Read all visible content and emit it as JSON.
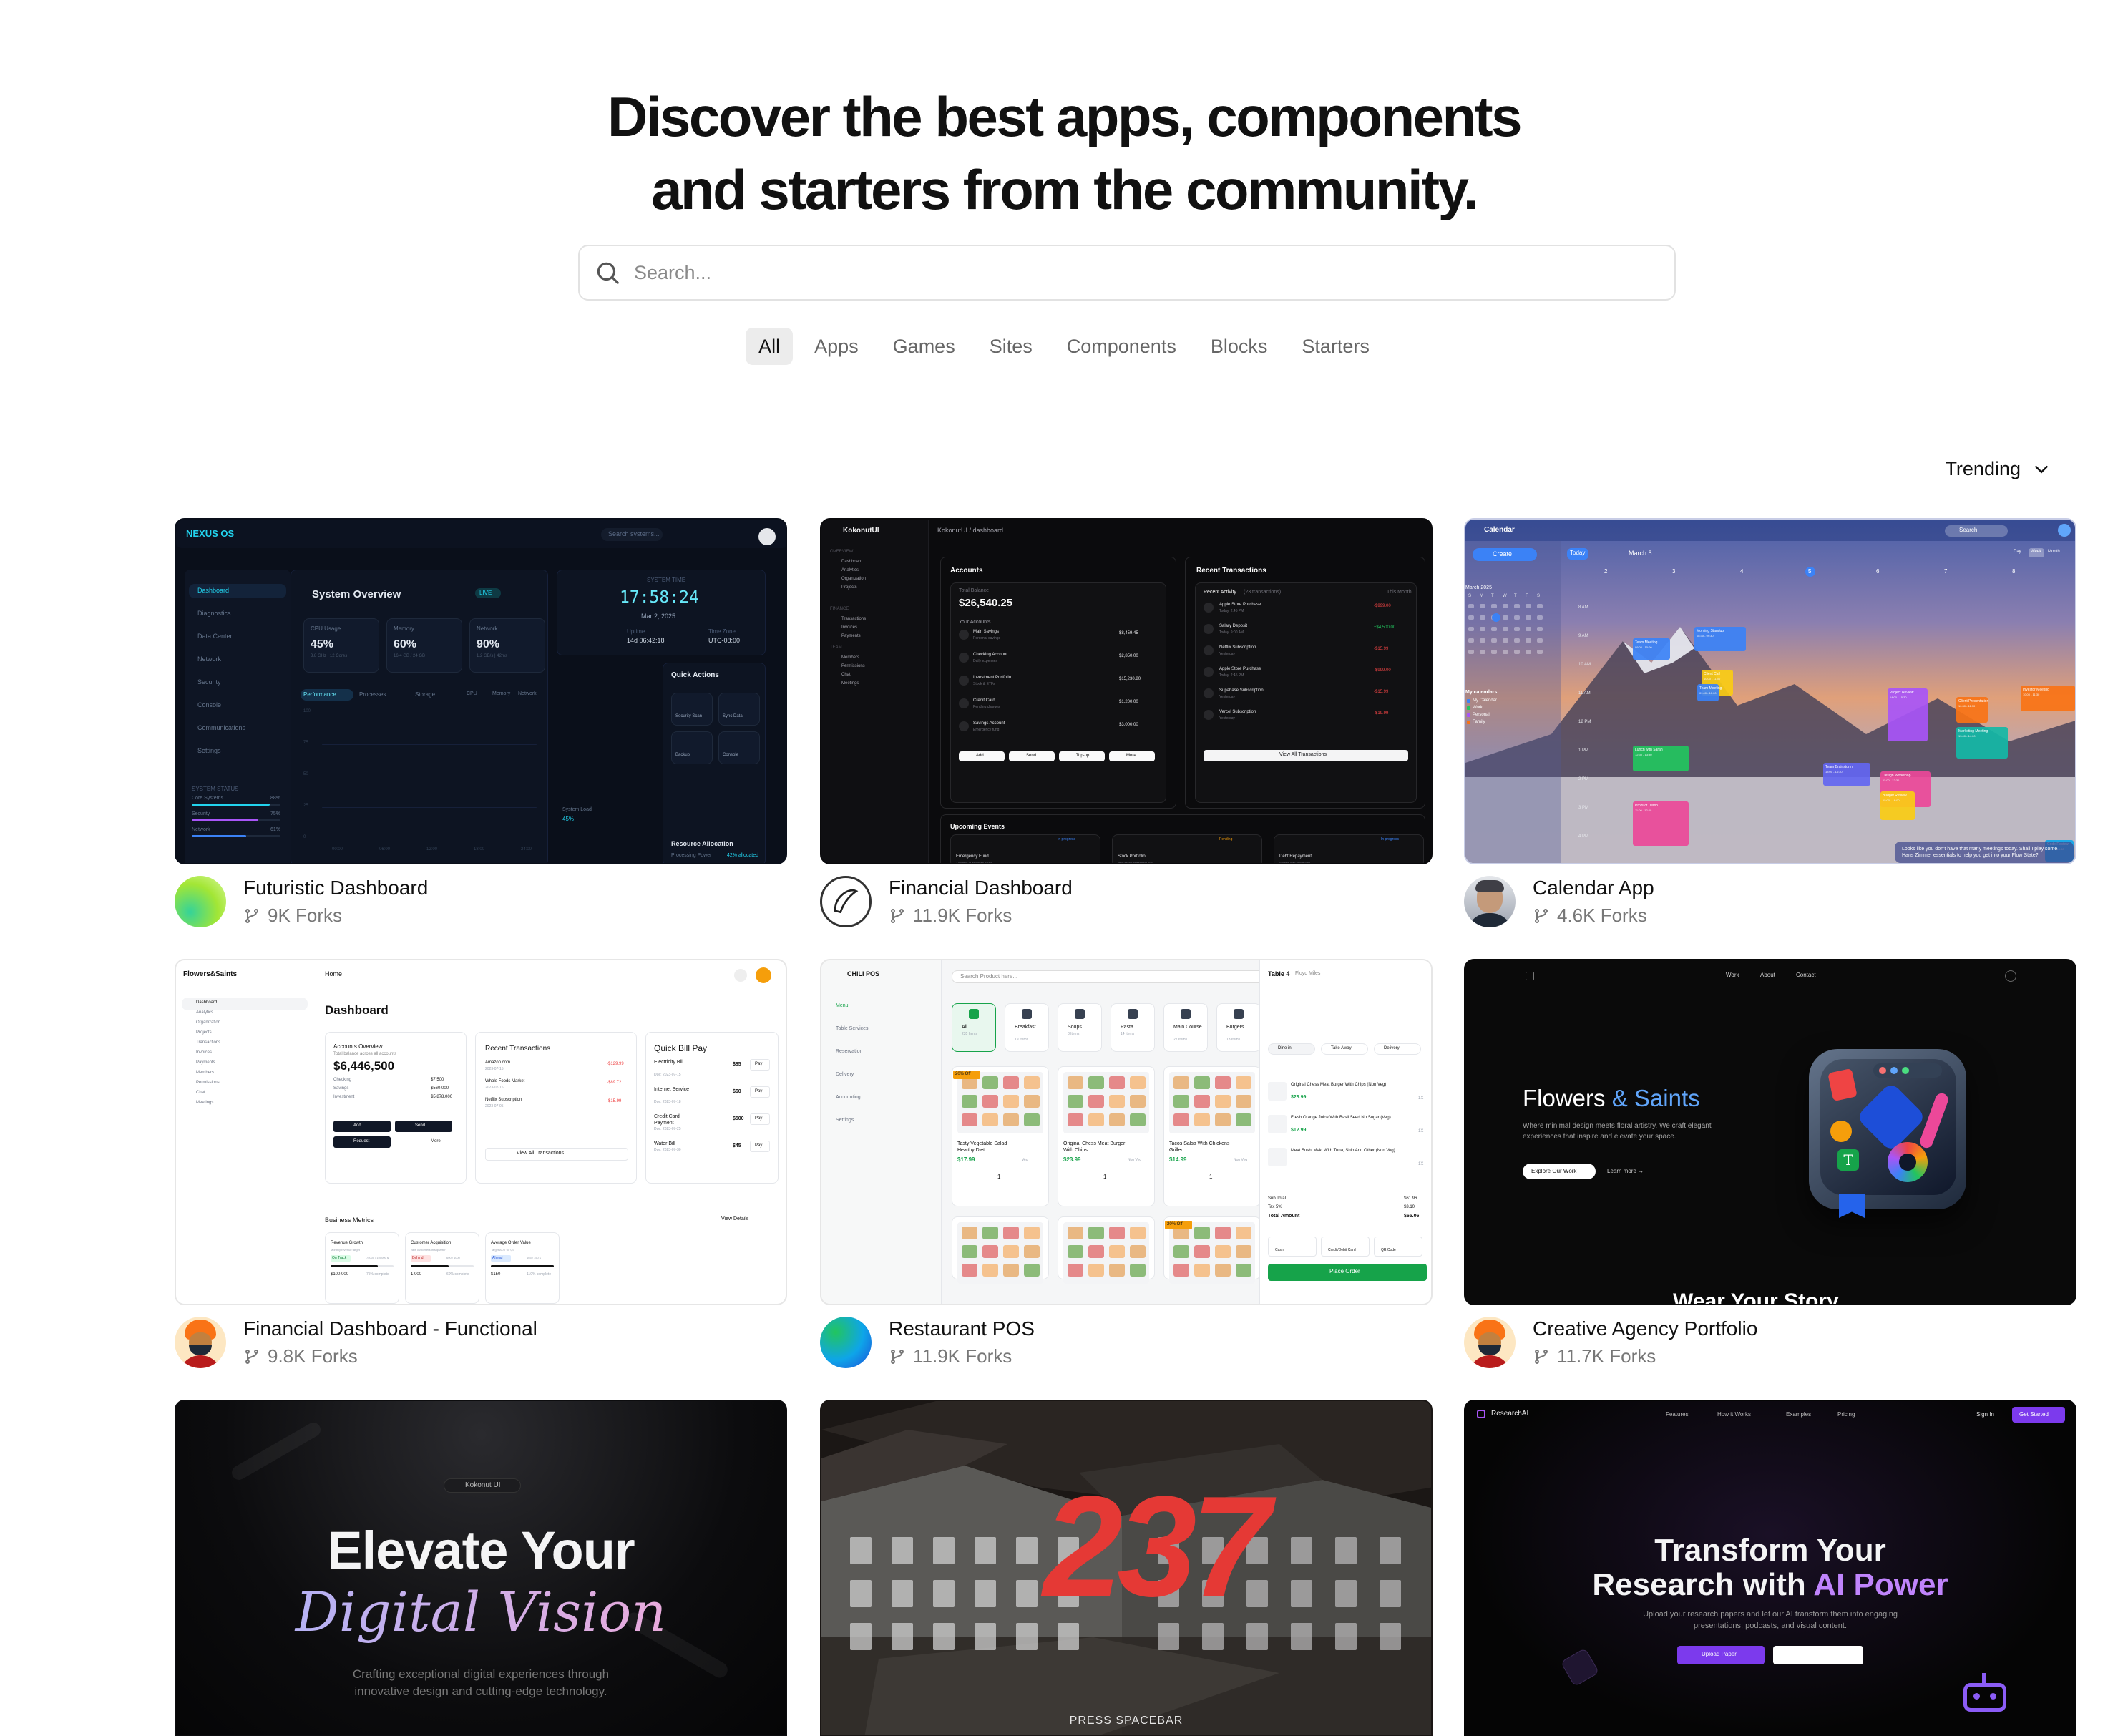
{
  "hero": {
    "line1": "Discover the best apps, components",
    "line2": "and starters from the community."
  },
  "search": {
    "placeholder": "Search..."
  },
  "filters": [
    "All",
    "Apps",
    "Games",
    "Sites",
    "Components",
    "Blocks",
    "Starters"
  ],
  "active_filter": "All",
  "sort": {
    "label": "Trending"
  },
  "cards": [
    {
      "title": "Futuristic Dashboard",
      "forks": "9K Forks",
      "avatar": "gradient-green",
      "thumb": {
        "brand": "NEXUS OS",
        "search": "Search systems...",
        "heading": "System Overview",
        "live": "LIVE",
        "time_label": "SYSTEM TIME",
        "time": "17:58:24",
        "date": "Mar 2, 2025",
        "nav": [
          "Dashboard",
          "Diagnostics",
          "Data Center",
          "Network",
          "Security",
          "Console",
          "Communications",
          "Settings"
        ],
        "status_label": "SYSTEM STATUS",
        "status_items": [
          "Core Systems",
          "Security",
          "Network"
        ],
        "status_values": [
          "88%",
          "75%",
          "61%"
        ],
        "metrics": [
          {
            "label": "CPU Usage",
            "value": "45%",
            "sub": "3.8 GHz | 12 Cores"
          },
          {
            "label": "Memory",
            "value": "60%",
            "sub": "16.4 GB / 24 GB"
          },
          {
            "label": "Network",
            "value": "90%",
            "sub": "1.2 GB/s | 42ms"
          }
        ],
        "chart_tabs": [
          "Performance",
          "Processes",
          "Storage"
        ],
        "chart_legend": [
          "CPU",
          "Memory",
          "Network"
        ],
        "chart_ticks": [
          "00:00",
          "06:00",
          "12:00",
          "18:00",
          "24:00"
        ],
        "chart_y": [
          "100",
          "75",
          "50",
          "25",
          "0"
        ],
        "system_load_label": "System Load",
        "system_load": "45%",
        "uptime_label": "Uptime",
        "uptime": "14d 06:42:18",
        "timezone_label": "Time Zone",
        "timezone": "UTC-08:00",
        "quick_actions": "Quick Actions",
        "actions": [
          "Security Scan",
          "Sync Data",
          "Backup",
          "Console"
        ],
        "resource": "Resource Allocation",
        "processing": "Processing Power",
        "processing_val": "42% allocated"
      }
    },
    {
      "title": "Financial Dashboard",
      "forks": "11.9K Forks",
      "avatar": "ring-logo",
      "thumb": {
        "brand": "KokonutUI",
        "crumb": "KokonutUI / dashboard",
        "overview": "OVERVIEW",
        "nav": [
          "Dashboard",
          "Analytics",
          "Organization",
          "Projects"
        ],
        "finance_label": "FINANCE",
        "finance_nav": [
          "Transactions",
          "Invoices",
          "Payments"
        ],
        "team_label": "TEAM",
        "team_nav": [
          "Members",
          "Permissions",
          "Chat",
          "Meetings"
        ],
        "accounts": "Accounts",
        "total_label": "Total Balance",
        "total": "$26,540.25",
        "your_accounts": "Your Accounts",
        "account_rows": [
          {
            "name": "Main Savings",
            "sub": "Personal savings",
            "amount": "$8,459.45"
          },
          {
            "name": "Checking Account",
            "sub": "Daily expenses",
            "amount": "$2,850.00"
          },
          {
            "name": "Investment Portfolio",
            "sub": "Stock & ETFs",
            "amount": "$15,230.80"
          },
          {
            "name": "Credit Card",
            "sub": "Pending charges",
            "amount": "$1,200.00"
          },
          {
            "name": "Savings Account",
            "sub": "Emergency fund",
            "amount": "$3,000.00"
          }
        ],
        "account_actions": [
          "Add",
          "Send",
          "Top-up",
          "More"
        ],
        "recent": "Recent Transactions",
        "recent_activity": "Recent Activity",
        "recent_count": "(23 transactions)",
        "this_month": "This Month",
        "tx_rows": [
          {
            "name": "Apple Store Purchase",
            "sub": "Today, 2:45 PM",
            "amount": "-$999.00"
          },
          {
            "name": "Salary Deposit",
            "sub": "Today, 9:00 AM",
            "amount": "+$4,500.00"
          },
          {
            "name": "Netflix Subscription",
            "sub": "Yesterday",
            "amount": "-$15.99"
          },
          {
            "name": "Apple Store Purchase",
            "sub": "Today, 2:45 PM",
            "amount": "-$999.00"
          },
          {
            "name": "Supabase Subscription",
            "sub": "Yesterday",
            "amount": "-$15.99"
          },
          {
            "name": "Vercel Subscription",
            "sub": "Yesterday",
            "amount": "-$19.99"
          }
        ],
        "view_all": "View All Transactions",
        "upcoming": "Upcoming Events",
        "events": [
          {
            "title": "Emergency Fund",
            "sub": "3 months of expenses saved",
            "tag": "In progress"
          },
          {
            "title": "Stock Portfolio",
            "sub": "Tech sector investment plan",
            "tag": "Pending"
          },
          {
            "title": "Debt Repayment",
            "sub": "Student loan payoff plan",
            "tag": "In progress"
          }
        ]
      }
    },
    {
      "title": "Calendar App",
      "forks": "4.6K Forks",
      "avatar": "person-photo",
      "thumb": {
        "brand": "Calendar",
        "search": "Search",
        "create": "Create",
        "today": "Today",
        "month": "March 5",
        "views": [
          "Day",
          "Week",
          "Month"
        ],
        "mini_month": "March 2025",
        "days": [
          "S",
          "M",
          "T",
          "W",
          "T",
          "F",
          "S"
        ],
        "my_calendars": "My calendars",
        "calendars": [
          "My Calendar",
          "Work",
          "Personal",
          "Family"
        ],
        "events": [
          {
            "title": "Team Meeting",
            "sub": "09:00 - 10:00",
            "color": "#3b82f6"
          },
          {
            "title": "Lunch with Sarah",
            "sub": "12:30 - 13:30",
            "color": "#22c55e"
          },
          {
            "title": "Project Review",
            "sub": "14:00 - 15:30",
            "color": "#a855f7"
          },
          {
            "title": "Client Call",
            "sub": "10:00 - 11:00",
            "color": "#facc15"
          },
          {
            "title": "Team Brainstorm",
            "sub": "13:00 - 14:30",
            "color": "#6366f1"
          },
          {
            "title": "Product Demo",
            "sub": "11:00 - 12:00",
            "color": "#ec4899"
          },
          {
            "title": "Marketing Meeting",
            "sub": "13:00 - 14:00",
            "color": "#14b8a6"
          },
          {
            "title": "Code Review",
            "sub": "15:00 - 16:00",
            "color": "#0ea5e9"
          },
          {
            "title": "Morning Standup",
            "sub": "08:30 - 09:30",
            "color": "#3b82f6"
          },
          {
            "title": "Design Workshop",
            "sub": "11:00 - 12:30",
            "color": "#ec4899"
          },
          {
            "title": "Budget Review",
            "sub": "15:00 - 16:00",
            "color": "#facc15"
          },
          {
            "title": "Client Presentation",
            "sub": "10:30 - 11:30",
            "color": "#f97316"
          },
          {
            "title": "Investor Meeting",
            "sub": "10:00 - 11:30",
            "color": "#f97316"
          },
          {
            "title": "Team Meeting",
            "sub": "09:00 - 10:00",
            "color": "#3b82f6"
          }
        ],
        "hours": [
          "8 AM",
          "9 AM",
          "10 AM",
          "11 AM",
          "12 PM",
          "1 PM",
          "2 PM",
          "3 PM",
          "4 PM"
        ],
        "cols": [
          "2",
          "3",
          "4",
          "5",
          "6",
          "7",
          "8"
        ],
        "today_num": "5",
        "toast": "Looks like you don't have that many meetings today. Shall I play some Hans Zimmer essentials to help you get into your Flow State?"
      }
    },
    {
      "title": "Financial Dashboard - Functional",
      "forks": "9.8K Forks",
      "avatar": "person-cartoon",
      "thumb": {
        "brand": "Flowers&Saints",
        "home": "Home",
        "heading": "Dashboard",
        "nav": [
          "Dashboard",
          "Analytics",
          "Organization",
          "Projects",
          "Transactions",
          "Invoices",
          "Payments",
          "Members",
          "Permissions",
          "Chat",
          "Meetings"
        ],
        "acc_title": "Accounts Overview",
        "acc_sub": "Total balance across all accounts",
        "acc_total": "$6,446,500",
        "acc_rows": [
          [
            "Checking",
            "$7,500"
          ],
          [
            "Savings",
            "$560,000"
          ],
          [
            "Investment",
            "$5,878,000"
          ]
        ],
        "acc_actions": [
          "Add",
          "Send",
          "Request",
          "More"
        ],
        "rt_title": "Recent Transactions",
        "rt_rows": [
          {
            "name": "Amazon.com",
            "date": "2023-07-15",
            "amount": "-$129.99"
          },
          {
            "name": "Whole Foods Market",
            "date": "2023-07-16",
            "amount": "-$89.72"
          },
          {
            "name": "Netflix Subscription",
            "date": "2023-07-05",
            "amount": "-$15.99"
          }
        ],
        "rt_view": "View All Transactions",
        "qb_title": "Quick Bill Pay",
        "qb_rows": [
          {
            "name": "Electricity Bill",
            "due": "Due: 2023-07-15",
            "amount": "$85",
            "btn": "Pay"
          },
          {
            "name": "Internet Service",
            "due": "Due: 2023-07-18",
            "amount": "$60",
            "btn": "Pay"
          },
          {
            "name": "Credit Card Payment",
            "due": "Due: 2023-07-25",
            "amount": "$500",
            "btn": "Pay"
          },
          {
            "name": "Water Bill",
            "due": "Due: 2023-07-30",
            "amount": "$45",
            "btn": "Pay"
          }
        ],
        "bm_title": "Business Metrics",
        "bm_view": "View Details",
        "metrics": [
          {
            "name": "Revenue Growth",
            "sub": "Monthly revenue target",
            "tag": "On Track",
            "value": "$100,000",
            "progress": "75% complete",
            "pct": 0.75
          },
          {
            "name": "Customer Acquisition",
            "sub": "New customers this quarter",
            "tag": "Behind",
            "value": "1,000",
            "progress": "60% complete",
            "pct": 0.6
          },
          {
            "name": "Average Order Value",
            "sub": "Target AOV for Q3",
            "tag": "Ahead",
            "value": "$150",
            "progress": "110% complete",
            "pct": 1.0
          }
        ],
        "metric_counts": [
          "75000 / 100000 $",
          "600 / 1000",
          "165 / 150 $"
        ]
      }
    },
    {
      "title": "Restaurant POS",
      "forks": "11.9K Forks",
      "avatar": "gradient-blue",
      "thumb": {
        "brand": "CHILI POS",
        "search": "Search Product here...",
        "nav": [
          "Menu",
          "Table Services",
          "Reservation",
          "Delivery",
          "Accounting",
          "Settings"
        ],
        "categories": [
          {
            "name": "All",
            "sub": "235 Items"
          },
          {
            "name": "Breakfast",
            "sub": "19 Items"
          },
          {
            "name": "Soups",
            "sub": "8 Items"
          },
          {
            "name": "Pasta",
            "sub": "14 Items"
          },
          {
            "name": "Main Course",
            "sub": "27 Items"
          },
          {
            "name": "Burgers",
            "sub": "13 Items"
          }
        ],
        "products": [
          {
            "name": "Tasty Vegetable Salad Healthy Diet",
            "price": "$17.99",
            "tag": "Veg",
            "badge": "20% Off"
          },
          {
            "name": "Original Chess Meat Burger With Chips",
            "price": "$23.99",
            "tag": "Non Veg",
            "badge": ""
          },
          {
            "name": "Tacos Salsa With Chickens Grilled",
            "price": "$14.99",
            "tag": "Non Veg",
            "badge": ""
          },
          {
            "name": "",
            "price": "",
            "tag": "",
            "badge": ""
          },
          {
            "name": "",
            "price": "",
            "tag": "",
            "badge": ""
          },
          {
            "name": "",
            "price": "",
            "tag": "",
            "badge": "20% Off"
          }
        ],
        "qty": "1",
        "table": "Table 4",
        "table_sub": "Floyd Miles",
        "order_types": [
          "Dine in",
          "Take Away",
          "Delivery"
        ],
        "order": [
          {
            "name": "Original Chess Meat Burger With Chips (Non Veg)",
            "price": "$23.99",
            "qty": "1X"
          },
          {
            "name": "Fresh Orange Juice With Basil Seed No Sugar (Veg)",
            "price": "$12.99",
            "qty": "1X"
          },
          {
            "name": "Meat Sushi Maki With Tuna, Ship And Other (Non Veg)",
            "price": "",
            "qty": "1X"
          }
        ],
        "subtotal_label": "Sub Total",
        "subtotal": "$61.96",
        "tax_label": "Tax 5%",
        "tax": "$3.10",
        "total_label": "Total Amount",
        "total": "$65.06",
        "pay": [
          "Cash",
          "Credit/Debit Card",
          "QR Code"
        ],
        "place": "Place Order"
      }
    },
    {
      "title": "Creative Agency Portfolio",
      "forks": "11.7K Forks",
      "avatar": "person-cartoon",
      "thumb": {
        "nav": [
          "Work",
          "About",
          "Contact"
        ],
        "title_a": "Flowers",
        "title_amp": "&",
        "title_b": "Saints",
        "sub": "Where minimal design meets floral artistry. We craft elegant experiences that inspire and elevate your space.",
        "cta": "Explore Our Work",
        "link": "Learn more →",
        "footer": "Wear Your Story"
      }
    },
    {
      "title": "",
      "forks": "",
      "avatar": "",
      "thumb": {
        "badge": "Kokonut UI",
        "line1": "Elevate Your",
        "line2": "Digital Vision",
        "sub1": "Crafting exceptional digital experiences through",
        "sub2": "innovative design and cutting-edge technology."
      }
    },
    {
      "title": "",
      "forks": "",
      "avatar": "",
      "thumb": {
        "number": "237",
        "prompt": "PRESS SPACEBAR"
      }
    },
    {
      "title": "",
      "forks": "",
      "avatar": "",
      "thumb": {
        "brand": "ResearchAI",
        "nav": [
          "Features",
          "How it Works",
          "Examples",
          "Pricing"
        ],
        "signin": "Sign In",
        "cta": "Get Started",
        "line1": "Transform Your",
        "line2a": "Research with ",
        "line2b": "AI Power",
        "sub": "Upload your research papers and let our AI transform them into engaging presentations, podcasts, and visual content.",
        "upload": "Upload Paper"
      }
    }
  ],
  "colors": {
    "accent_purple": "#7c3aed",
    "cyan": "#22d3ee",
    "pos_green": "#16a34a",
    "red": "#e53935"
  }
}
